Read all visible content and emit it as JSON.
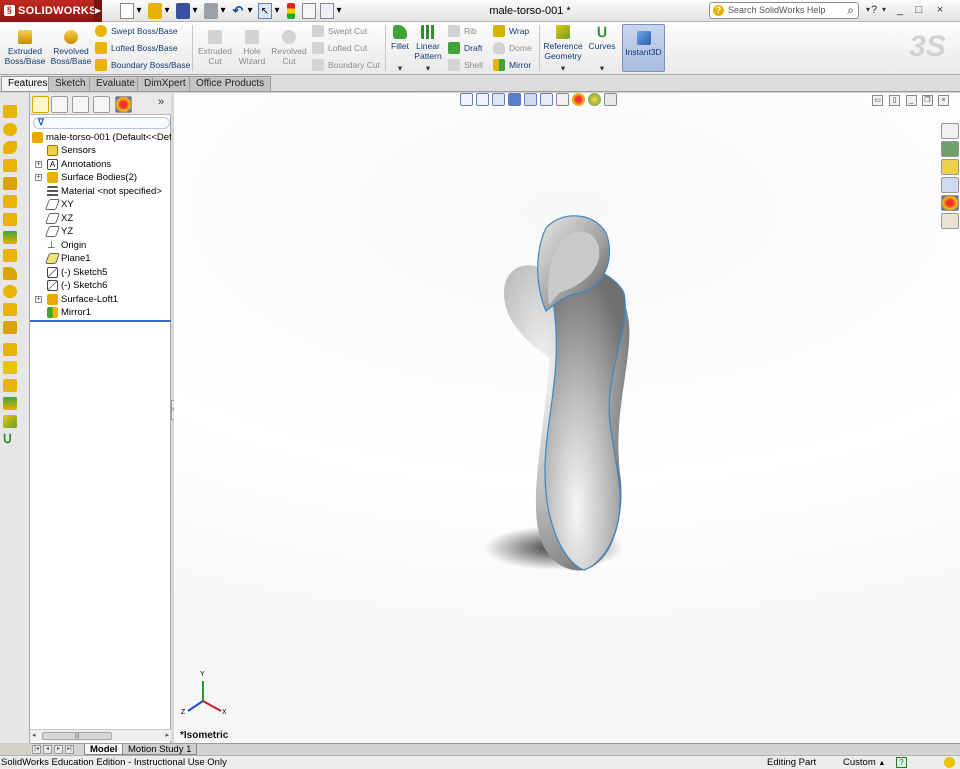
{
  "app": {
    "brand": "SOLIDWORKS",
    "document_title": "male-torso-001 *"
  },
  "help": {
    "search_placeholder": "Search SolidWorks Help"
  },
  "quick_access": {
    "window_controls": [
      "_",
      "□",
      "×"
    ]
  },
  "command_manager": {
    "boss": [
      {
        "id": "extruded-boss",
        "label_1": "Extruded",
        "label_2": "Boss/Base",
        "icon": "extruded-boss-icon"
      },
      {
        "id": "revolved-boss",
        "label_1": "Revolved",
        "label_2": "Boss/Base",
        "icon": "revolved-boss-icon"
      }
    ],
    "boss_small": [
      "Swept Boss/Base",
      "Lofted Boss/Base",
      "Boundary Boss/Base"
    ],
    "cut": [
      {
        "id": "extruded-cut",
        "label_1": "Extruded",
        "label_2": "Cut"
      },
      {
        "id": "hole-wizard",
        "label_1": "Hole",
        "label_2": "Wizard"
      },
      {
        "id": "revolved-cut",
        "label_1": "Revolved",
        "label_2": "Cut"
      }
    ],
    "cut_small": [
      "Swept Cut",
      "Lofted Cut",
      "Boundary Cut"
    ],
    "fillet": "Fillet",
    "linear_pattern": {
      "label_1": "Linear",
      "label_2": "Pattern"
    },
    "features_small_col1": [
      "Rib",
      "Draft",
      "Shell"
    ],
    "features_small_col2": [
      "Wrap",
      "Dome",
      "Mirror"
    ],
    "reference_geometry": {
      "label_1": "Reference",
      "label_2": "Geometry"
    },
    "curves": "Curves",
    "instant3d": "Instant3D"
  },
  "tabs": [
    "Features",
    "Sketch",
    "Evaluate",
    "DimXpert",
    "Office Products"
  ],
  "active_tab": "Features",
  "feature_tree": {
    "root": "male-torso-001  (Default<<Def",
    "items": [
      "Sensors",
      "Annotations",
      "Surface Bodies(2)",
      "Material <not specified>",
      "XY",
      "XZ",
      "YZ",
      "Origin",
      "Plane1",
      "(-) Sketch5",
      "(-) Sketch6",
      "Surface-Loft1",
      "Mirror1"
    ]
  },
  "viewport": {
    "view_name": "*Isometric",
    "triad": {
      "x": "X",
      "y": "Y",
      "z": "Z"
    }
  },
  "bottom_tabs": [
    "Model",
    "Motion Study 1"
  ],
  "status": {
    "left": "SolidWorks Education Edition - Instructional Use Only",
    "editing": "Editing Part",
    "units": "Custom",
    "units_arrow": "▲",
    "help_icon_label": "?"
  },
  "colors": {
    "accent": "#3a6cc6",
    "brand_red": "#b01e16",
    "tree_icon": "#e8a800"
  }
}
